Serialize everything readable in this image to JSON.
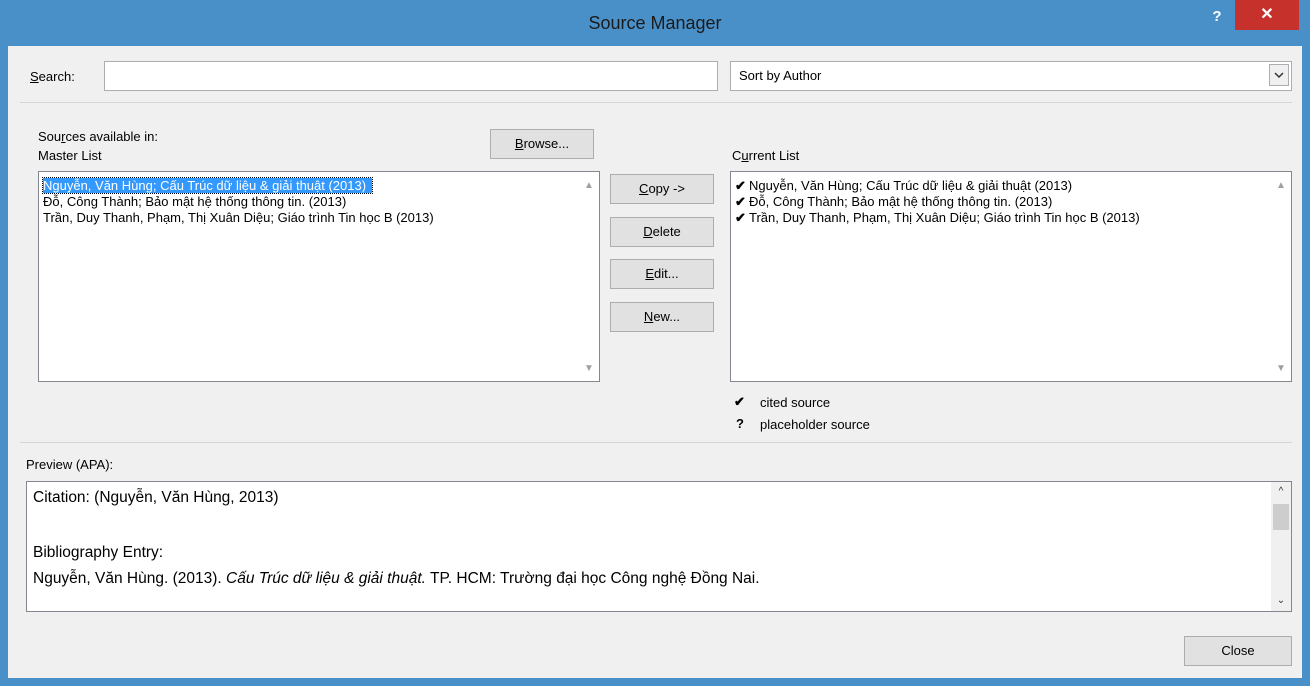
{
  "window": {
    "title": "Source Manager",
    "help_glyph": "?",
    "close_glyph": "✕"
  },
  "search": {
    "label_prefix": "",
    "label_ul": "S",
    "label_rest": "earch:",
    "value": "",
    "placeholder": ""
  },
  "sort": {
    "selected": "Sort by Author"
  },
  "master": {
    "sources_label_a": "Sou",
    "sources_label_ul": "r",
    "sources_label_b": "ces available in:",
    "title": "Master List",
    "browse_ul": "B",
    "browse_rest": "rowse...",
    "items": [
      "Nguyễn, Văn Hùng; Cấu Trúc dữ liệu & giải thuật (2013)",
      "Đỗ, Công Thành; Bảo mật hệ thống thông tin. (2013)",
      "Trần, Duy Thanh, Phạm, Thị Xuân Diệu; Giáo trình Tin học B (2013)"
    ]
  },
  "actions": {
    "copy_ul": "C",
    "copy_rest": "opy ->",
    "delete_ul": "D",
    "delete_rest": "elete",
    "edit_ul": "E",
    "edit_rest": "dit...",
    "new_ul": "N",
    "new_rest": "ew..."
  },
  "current": {
    "title_a": "C",
    "title_ul": "u",
    "title_b": "rrent List",
    "check_glyph": "✔",
    "items": [
      "Nguyễn, Văn Hùng; Cấu Trúc dữ liệu & giải thuật (2013)",
      "Đỗ, Công Thành; Bảo mật hệ thống thông tin. (2013)",
      "Trần, Duy Thanh, Phạm, Thị Xuân Diệu; Giáo trình Tin học B (2013)"
    ],
    "legend": {
      "cited_glyph": "✔",
      "cited": "cited source",
      "placeholder_glyph": "?",
      "placeholder": "placeholder source"
    }
  },
  "preview": {
    "label": "Preview (APA):",
    "citation": "Citation:  (Nguyễn, Văn Hùng, 2013)",
    "bib_label": "Bibliography Entry:",
    "bib_author": "Nguyễn, Văn Hùng. (2013). ",
    "bib_title": "Cấu Trúc dữ liệu & giải thuật.",
    "bib_rest": " TP. HCM: Trường đại học Công nghệ Đồng Nai."
  },
  "close_label": "Close",
  "colors": {
    "titlebar": "#4a90c8",
    "close": "#c7312b",
    "selection": "#3399ff",
    "dialog": "#f0f0f0"
  }
}
